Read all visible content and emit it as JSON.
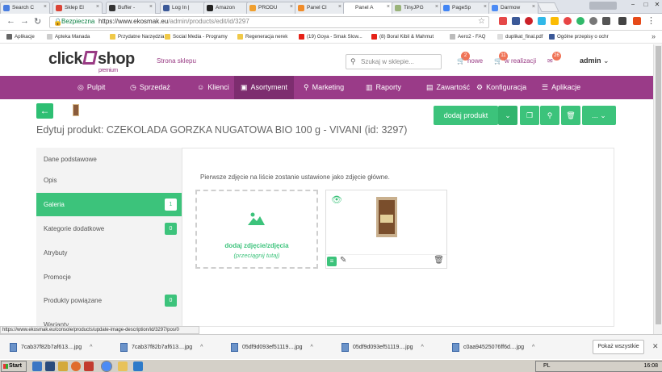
{
  "browser": {
    "tabs": [
      {
        "label": "Search C",
        "fav": "#4a7ee0",
        "active": false
      },
      {
        "label": "Sklep El",
        "fav": "#db4437",
        "active": false
      },
      {
        "label": "Buffer -",
        "fav": "#333333",
        "active": false
      },
      {
        "label": "Log In |",
        "fav": "#3b5998",
        "active": false
      },
      {
        "label": "Amazon",
        "fav": "#222222",
        "active": false
      },
      {
        "label": "PRODU",
        "fav": "#f0a030",
        "active": false
      },
      {
        "label": "Panel Cl",
        "fav": "#f08c2a",
        "active": false
      },
      {
        "label": "Panel A",
        "fav": "#ffffff",
        "active": true
      },
      {
        "label": "TinyJPG",
        "fav": "#9ab37a",
        "active": false
      },
      {
        "label": "PageSp",
        "fav": "#4285f4",
        "active": false
      },
      {
        "label": "Darmow",
        "fav": "#4c8bf5",
        "active": false
      }
    ],
    "window_controls": [
      "−",
      "□",
      "✕"
    ],
    "profile_label": "Bezpieczna",
    "url_base": "https://www.ekosmak.eu",
    "url_path": "/admin/products/edit/id/3297",
    "bookmarks": [
      {
        "label": "Aplikacje",
        "color": "#666666"
      },
      {
        "label": "Apteka Manada",
        "color": "#cccccc"
      },
      {
        "label": "Przydatne Narzędzia",
        "color": "#f0c948"
      },
      {
        "label": "Social Media - Programy",
        "color": "#f0c948"
      },
      {
        "label": "Regeneracja nerek",
        "color": "#f0c948"
      },
      {
        "label": "(19) Goya - Smak Slow...",
        "color": "#e62117"
      },
      {
        "label": "(8) Boral Kibil & Mahmut",
        "color": "#e62117"
      },
      {
        "label": "Aero2 - FAQ",
        "color": "#bbbbbb"
      },
      {
        "label": "duplikat_final.pdf",
        "color": "#dddddd"
      },
      {
        "label": "Ogólne przepisy o ochr",
        "color": "#3b5998"
      }
    ]
  },
  "header": {
    "logo_a": "click",
    "logo_b": "shop",
    "logo_sub": "premium",
    "storefront_link": "Strona sklepu",
    "search_placeholder": "Szukaj w sklepie...",
    "new_label": "nowe",
    "new_count": "2",
    "in_progress_label": "w realizacji",
    "in_progress_count": "11",
    "messages_count": "26",
    "user": "admin"
  },
  "nav": [
    {
      "label": "Pulpit",
      "icon": "◎"
    },
    {
      "label": "Sprzedaż",
      "icon": "◷"
    },
    {
      "label": "Klienci",
      "icon": "☺"
    },
    {
      "label": "Asortyment",
      "icon": "▣"
    },
    {
      "label": "Marketing",
      "icon": "⚲"
    },
    {
      "label": "Raporty",
      "icon": "▥"
    },
    {
      "label": "Zawartość",
      "icon": "▤"
    },
    {
      "label": "Konfiguracja",
      "icon": "⚙"
    },
    {
      "label": "Aplikacje",
      "icon": "☰"
    }
  ],
  "page": {
    "title": "Edytuj produkt: CZEKOLADA GORZKA NUGATOWA BIO 100 g - VIVANI (id: 3297)",
    "add_product": "dodaj produkt",
    "more": "..."
  },
  "sidebar": [
    {
      "label": "Dane podstawowe",
      "count": ""
    },
    {
      "label": "Opis",
      "count": ""
    },
    {
      "label": "Galeria",
      "count": "1"
    },
    {
      "label": "Kategorie dodatkowe",
      "count": "0"
    },
    {
      "label": "Atrybuty",
      "count": ""
    },
    {
      "label": "Promocje",
      "count": ""
    },
    {
      "label": "Produkty powiązane",
      "count": "0"
    },
    {
      "label": "Warianty",
      "count": ""
    }
  ],
  "gallery": {
    "hint": "Pierwsze zdjęcie na liście zostanie ustawione jako zdjęcie główne.",
    "drop_main": "dodaj zdjęcie/zdjęcia",
    "drop_sub": "(przeciągnij tutaj)"
  },
  "status_url": "https://www.ekosmak.eu/console/products/update-image-description/id/3297/pos/0",
  "downloads": [
    {
      "name": "7cab37f82b7af613....jpg"
    },
    {
      "name": "7cab37f82b7af613....jpg"
    },
    {
      "name": "05df9d093ef51119....jpg"
    },
    {
      "name": "05df9d093ef51119....jpg"
    },
    {
      "name": "c0aa94525076ff6d....jpg"
    }
  ],
  "downloads_show_all": "Pokaż wszystkie",
  "taskbar": {
    "start": "Start",
    "lang": "PL",
    "time": "16:08"
  }
}
